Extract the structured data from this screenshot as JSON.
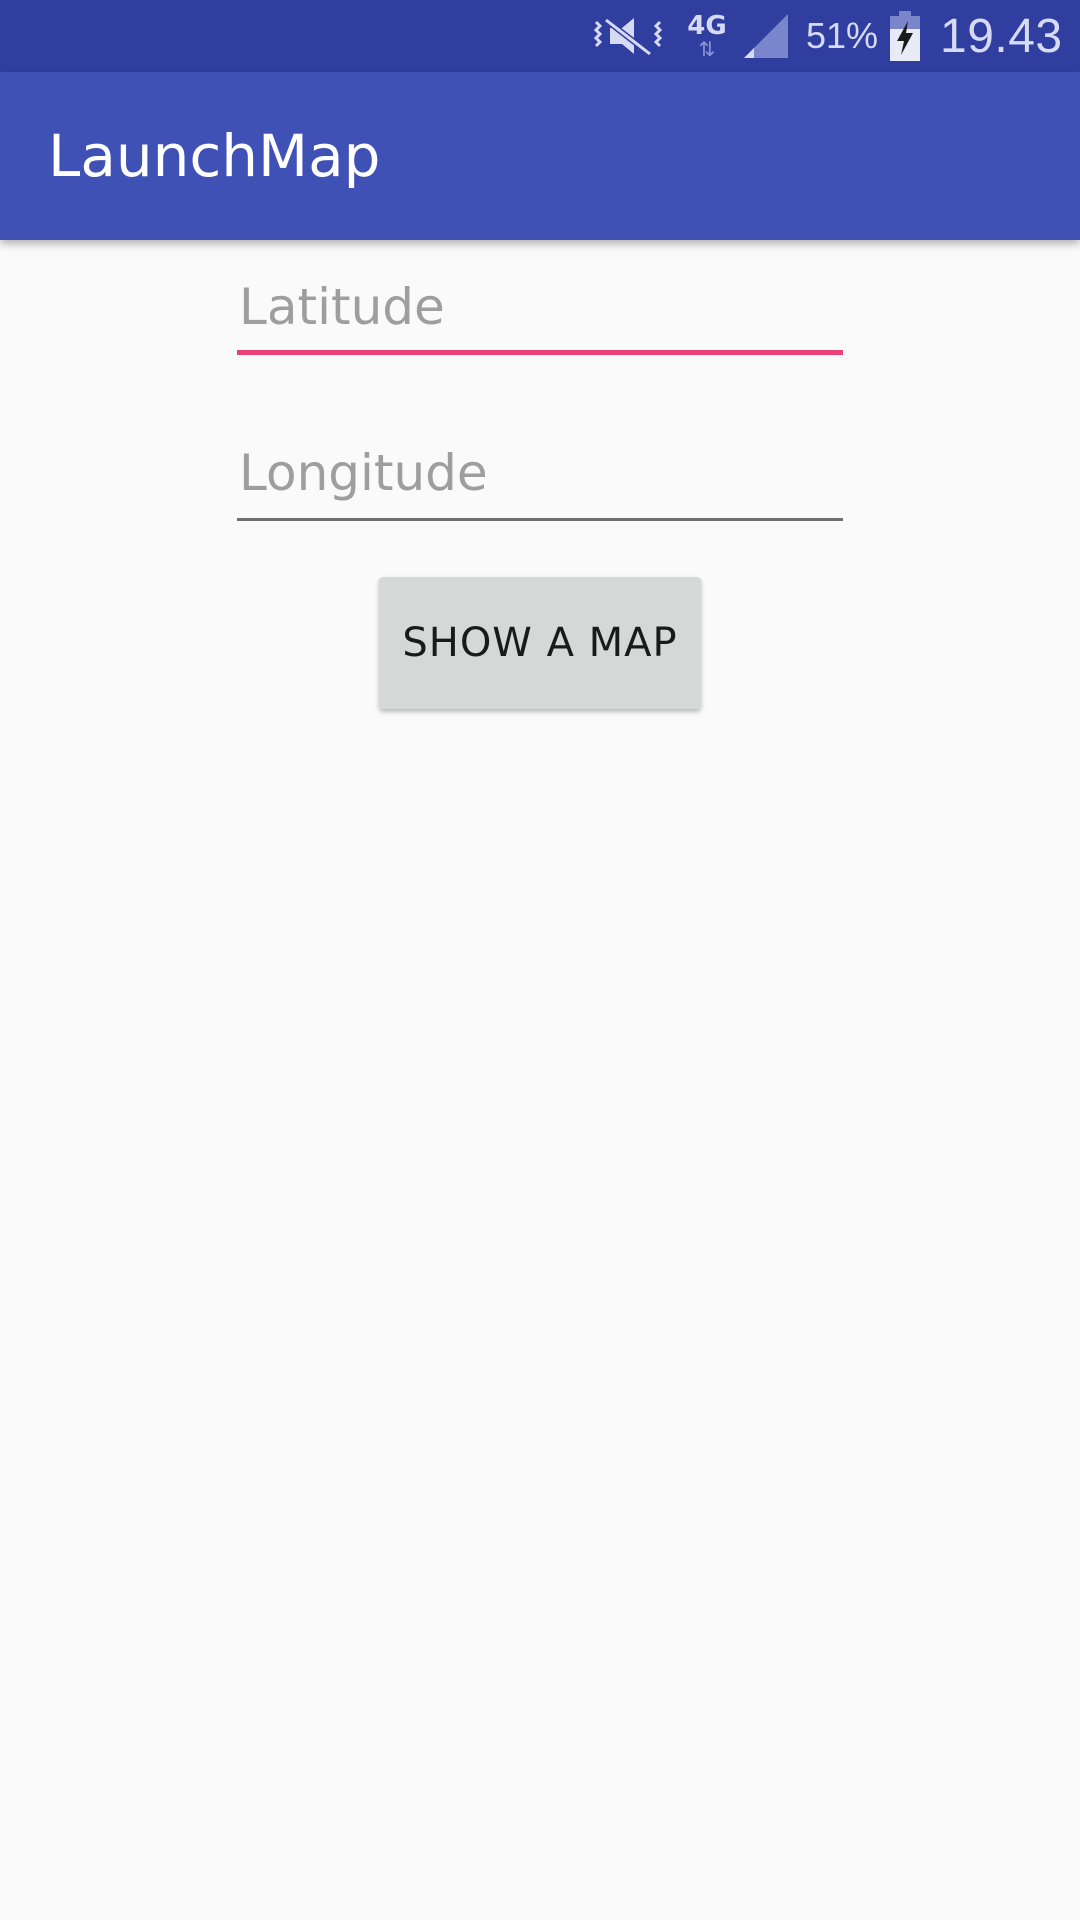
{
  "status_bar": {
    "icons": [
      "vibrate-mute-icon",
      "network-4g-icon",
      "signal-icon",
      "battery-charging-icon"
    ],
    "network_type": "4G",
    "network_arrows": "⇅",
    "battery_percent": "51%",
    "time": "19.43",
    "background_color": "#303f9f"
  },
  "app_bar": {
    "title": "LaunchMap",
    "background_color": "#3f51b5"
  },
  "form": {
    "latitude": {
      "placeholder": "Latitude",
      "value": "",
      "focused": true,
      "underline_color": "#ec407a"
    },
    "longitude": {
      "placeholder": "Longitude",
      "value": "",
      "focused": false,
      "underline_color": "#6f6f6f"
    },
    "show_map_button": {
      "label": "SHOW A MAP"
    }
  }
}
